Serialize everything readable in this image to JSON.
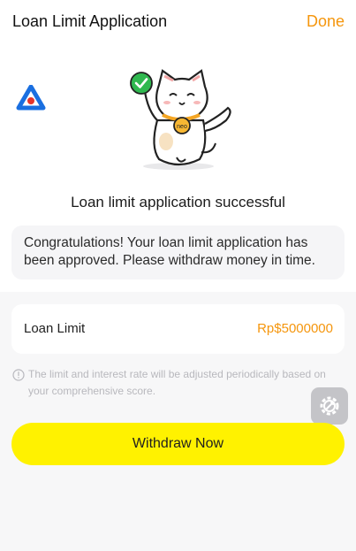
{
  "header": {
    "title": "Loan Limit Application",
    "done_label": "Done"
  },
  "icons": {
    "brand": "brand-logo-icon",
    "mascot": "lucky-cat-mascot",
    "check": "check-circle-icon",
    "info": "info-icon",
    "float": "gear-wrench-icon"
  },
  "result": {
    "headline": "Loan limit application successful",
    "message": "Congratulations! Your loan limit application has been approved. Please withdraw money in time.",
    "badge_text": "neo"
  },
  "limit": {
    "label": "Loan Limit",
    "value": "Rp$5000000"
  },
  "note": "The limit and interest rate will be adjusted periodically based on your comprehensive score.",
  "actions": {
    "withdraw_label": "Withdraw Now"
  },
  "colors": {
    "accent": "#f5960d",
    "button": "#fff200",
    "check": "#2fb84f",
    "brand_blue": "#1a6fe0",
    "brand_red": "#e5352b"
  }
}
